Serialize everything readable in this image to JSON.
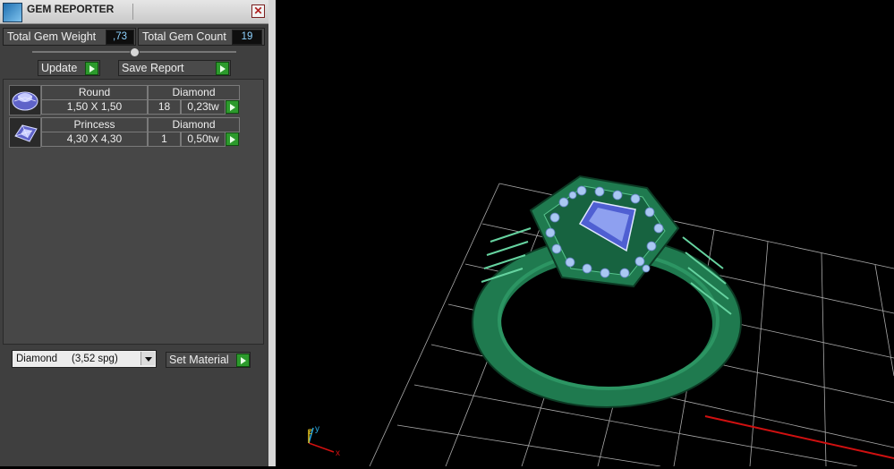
{
  "window": {
    "title": "GEM REPORTER",
    "close_glyph": "✕"
  },
  "stats": {
    "weight_label": "Total Gem Weight",
    "weight_value": ",73",
    "count_label": "Total Gem Count",
    "count_value": "19"
  },
  "buttons": {
    "update": "Update",
    "save_report": "Save Report",
    "set_material": "Set Material"
  },
  "gems": [
    {
      "shape": "Round",
      "type": "Diamond",
      "size": "1,50 X 1,50",
      "count": "18",
      "weight": "0,23tw",
      "icon": "round-gem-icon"
    },
    {
      "shape": "Princess",
      "type": "Diamond",
      "size": "4,30 X 4,30",
      "count": "1",
      "weight": "0,50tw",
      "icon": "princess-gem-icon"
    }
  ],
  "material": {
    "selected": "Diamond     (3,52 spg)"
  },
  "axes": {
    "z": "z",
    "y": "y",
    "x": "x"
  },
  "colors": {
    "ring": "#1f7a4f",
    "grid": "#d0d0d0",
    "x_axis": "#d01010",
    "y_axis": "#2aa8e0"
  }
}
